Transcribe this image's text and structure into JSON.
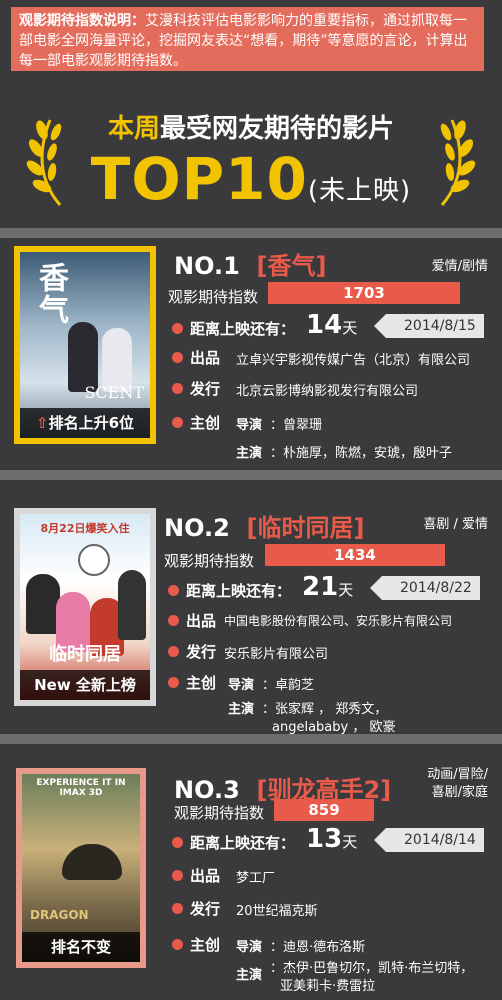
{
  "intro": {
    "heading": "观影期待指数说明：",
    "text": "艾漫科技评估电影影响力的重要指标，通过抓取每一部电影全网海量评论，挖掘网友表达“想看，期待”等意愿的言论，计算出每一部电影观影期待指数。"
  },
  "title": {
    "prefix": "本周",
    "main": "最受网友期待的影片",
    "top": "TOP10",
    "sub": "(未上映)"
  },
  "labels": {
    "index": "观影期待指数",
    "countdown": "距离上映还有：",
    "day_unit": "天",
    "producer": "出品",
    "distributor": "发行",
    "cast": "主创",
    "director": "导演",
    "stars": "主演"
  },
  "films": [
    {
      "rank": "NO.1",
      "name": "[香气]",
      "genre": "爱情/剧情",
      "index": "1703",
      "index_fraction": 1.0,
      "days": "14",
      "date": "2014/8/15",
      "producer": "立卓兴宇影视传媒广告（北京）有限公司",
      "distributor": "北京云影博纳影视发行有限公司",
      "director": "：曾翠珊",
      "stars": "：朴施厚，陈燃，安琥，殷叶子",
      "banner": "排名上升6位",
      "poster_title": "香气",
      "poster_en": "SCENT",
      "accent": "#f2c300"
    },
    {
      "rank": "NO.2",
      "name": "[临时同居]",
      "genre": "喜剧 / 爱情",
      "index": "1434",
      "index_fraction": 0.84,
      "days": "21",
      "date": "2014/8/22",
      "producer": "中国电影股份有限公司、安乐影片有限公司",
      "distributor": "安乐影片有限公司",
      "director": "：卓韵芝",
      "stars1": "：张家辉 ， 郑秀文，",
      "stars2": "angelababy ， 欧豪",
      "banner": "New 全新上榜",
      "poster_top": "8月22日爆笑入住",
      "poster_title": "临时同居",
      "accent": "#cfcfcf"
    },
    {
      "rank": "NO.3",
      "name": "[驯龙高手2]",
      "genre1": "动画/冒险/",
      "genre2": "喜剧/家庭",
      "index": "859",
      "index_fraction": 0.5,
      "days": "13",
      "date": "2014/8/14",
      "producer": "梦工厂",
      "distributor": "20世纪福克斯",
      "director": "：迪恩·德布洛斯",
      "stars1": "：杰伊·巴鲁切尔，凯特·布兰切特，",
      "stars2": "亚美莉卡·费雷拉",
      "banner": "排名不变",
      "poster_top": "EXPERIENCE IT IN IMAX 3D",
      "poster_title": "DRAGON",
      "accent": "#e89a8a"
    }
  ]
}
